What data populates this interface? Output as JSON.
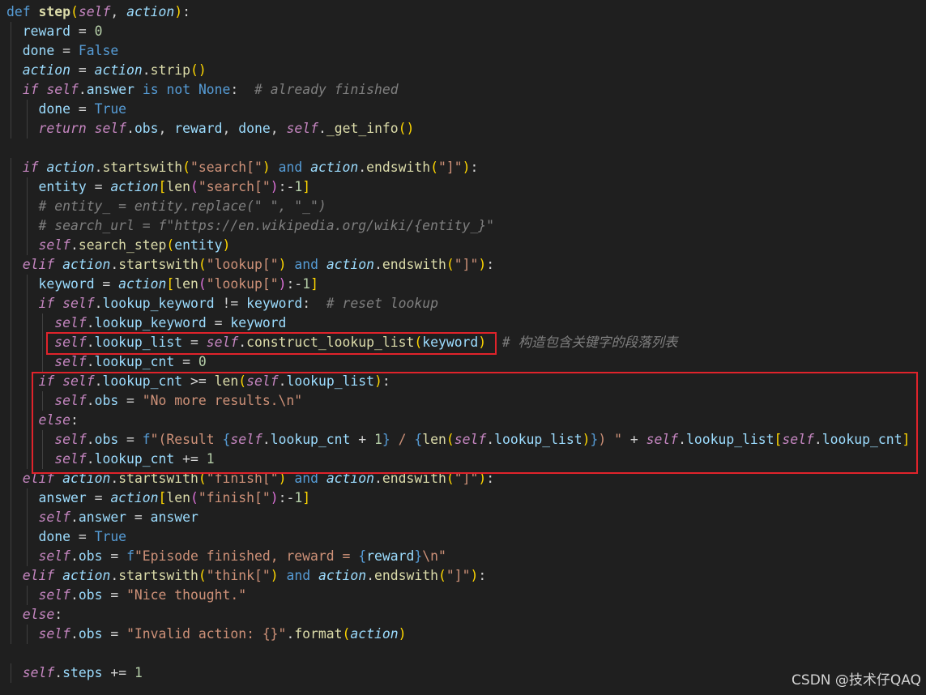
{
  "lines": [
    "def step(self, action):",
    "  reward = 0",
    "  done = False",
    "  action = action.strip()",
    "  if self.answer is not None:  # already finished",
    "    done = True",
    "    return self.obs, reward, done, self._get_info()",
    "",
    "  if action.startswith(\"search[\") and action.endswith(\"]\"):",
    "    entity = action[len(\"search[\"):-1]",
    "    # entity_ = entity.replace(\" \", \"_\")",
    "    # search_url = f\"https://en.wikipedia.org/wiki/{entity_}\"",
    "    self.search_step(entity)",
    "  elif action.startswith(\"lookup[\") and action.endswith(\"]\"):",
    "    keyword = action[len(\"lookup[\"):-1]",
    "    if self.lookup_keyword != keyword:  # reset lookup",
    "      self.lookup_keyword = keyword",
    "      self.lookup_list = self.construct_lookup_list(keyword)  # 构造包含关键字的段落列表",
    "      self.lookup_cnt = 0",
    "    if self.lookup_cnt >= len(self.lookup_list):",
    "      self.obs = \"No more results.\\n\"",
    "    else:",
    "      self.obs = f\"(Result {self.lookup_cnt + 1} / {len(self.lookup_list)}) \" + self.lookup_list[self.lookup_cnt]",
    "      self.lookup_cnt += 1",
    "  elif action.startswith(\"finish[\") and action.endswith(\"]\"):",
    "    answer = action[len(\"finish[\"):-1]",
    "    self.answer = answer",
    "    done = True",
    "    self.obs = f\"Episode finished, reward = {reward}\\n\"",
    "  elif action.startswith(\"think[\") and action.endswith(\"]\"):",
    "    self.obs = \"Nice thought.\"",
    "  else:",
    "    self.obs = \"Invalid action: {}\".format(action)",
    "",
    "  self.steps += 1"
  ],
  "annotation": {
    "comment_cn": "# 构造包含关键字的段落列表"
  },
  "watermark": "CSDN @技术仔QAQ",
  "colors": {
    "background": "#1f1f1f",
    "highlight_box": "#e0232b",
    "keyword": "#569cd6",
    "control": "#c586c0",
    "function": "#dcdcaa",
    "string": "#ce9178",
    "number": "#b5cea8",
    "comment": "#7f7f7f"
  }
}
